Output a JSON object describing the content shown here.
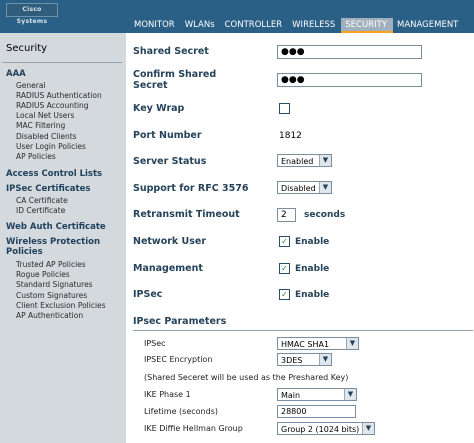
{
  "header": {
    "brand": "Cisco Systems",
    "nav": [
      "MONITOR",
      "WLANs",
      "CONTROLLER",
      "WIRELESS",
      "SECURITY",
      "MANAGEMENT"
    ],
    "active": "SECURITY"
  },
  "sidebar": {
    "title": "Security",
    "aaa": "AAA",
    "aaa_items": [
      "General",
      "RADIUS Authentication",
      "RADIUS Accounting",
      "Local Net Users",
      "MAC Filtering",
      "Disabled Clients",
      "User Login Policies",
      "AP Policies"
    ],
    "acl": "Access Control Lists",
    "ipsec_certs": "IPSec Certificates",
    "ipsec_items": [
      "CA Certificate",
      "ID Certificate"
    ],
    "web_auth": "Web Auth Certificate",
    "wps": "Wireless Protection Policies",
    "wps_items": [
      "Trusted AP Policies",
      "Rogue Policies",
      "Standard Signatures",
      "Custom Signatures",
      "Client Exclusion Policies",
      "AP Authentication"
    ]
  },
  "form": {
    "shared_secret": {
      "label": "Shared Secret",
      "value": "●●●"
    },
    "confirm_secret": {
      "label": "Confirm Shared Secret",
      "value": "●●●"
    },
    "key_wrap": {
      "label": "Key Wrap",
      "checked": false
    },
    "port": {
      "label": "Port Number",
      "value": "1812"
    },
    "server_status": {
      "label": "Server Status",
      "value": "Enabled"
    },
    "rfc3576": {
      "label": "Support for RFC 3576",
      "value": "Disabled"
    },
    "timeout": {
      "label": "Retransmit Timeout",
      "value": "2",
      "unit": "seconds"
    },
    "network_user": {
      "label": "Network User",
      "checked": true,
      "text": "Enable"
    },
    "management": {
      "label": "Management",
      "checked": true,
      "text": "Enable"
    },
    "ipsec": {
      "label": "IPSec",
      "checked": true,
      "text": "Enable"
    }
  },
  "ipsec_params": {
    "title": "IPsec Parameters",
    "ipsec": {
      "label": "IPSec",
      "value": "HMAC SHA1"
    },
    "encryption": {
      "label": "IPSEC Encryption",
      "value": "3DES"
    },
    "note": "(Shared Seceret will be used as the Preshared Key)",
    "ike_phase1": {
      "label": "IKE Phase 1",
      "value": "Main"
    },
    "lifetime": {
      "label": "Lifetime (seconds)",
      "value": "28800"
    },
    "dh_group": {
      "label": "IKE Diffie Hellman Group",
      "value": "Group 2 (1024 bits)"
    }
  },
  "icons": {
    "dropdown": "chevron-down-icon",
    "check": "check-icon"
  },
  "colors": {
    "header": "#2a5f86",
    "sidebar": "#d4d9dd",
    "accent": "#f9a21a",
    "label": "#25435a"
  }
}
